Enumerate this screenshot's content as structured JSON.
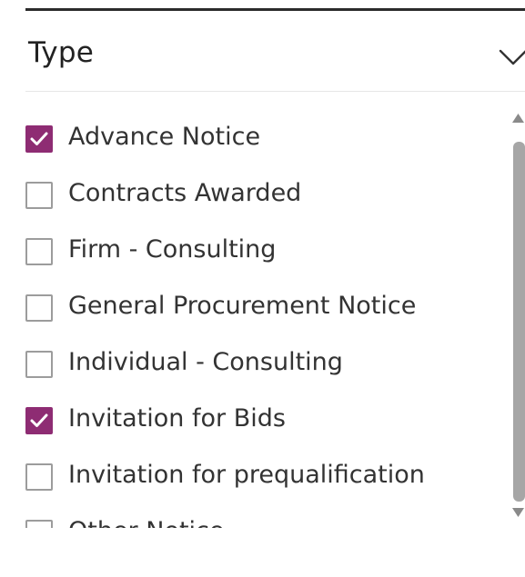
{
  "filter": {
    "title": "Type",
    "expanded": true,
    "chevron_icon": "chevron-down-icon",
    "accent_color": "#8e2c73",
    "items": [
      {
        "label": "Advance Notice",
        "checked": true
      },
      {
        "label": "Contracts Awarded",
        "checked": false
      },
      {
        "label": "Firm - Consulting",
        "checked": false
      },
      {
        "label": "General Procurement Notice",
        "checked": false
      },
      {
        "label": "Individual - Consulting",
        "checked": false
      },
      {
        "label": "Invitation for Bids",
        "checked": true
      },
      {
        "label": "Invitation for prequalification",
        "checked": false
      },
      {
        "label": "Other Notice",
        "checked": false
      }
    ]
  }
}
